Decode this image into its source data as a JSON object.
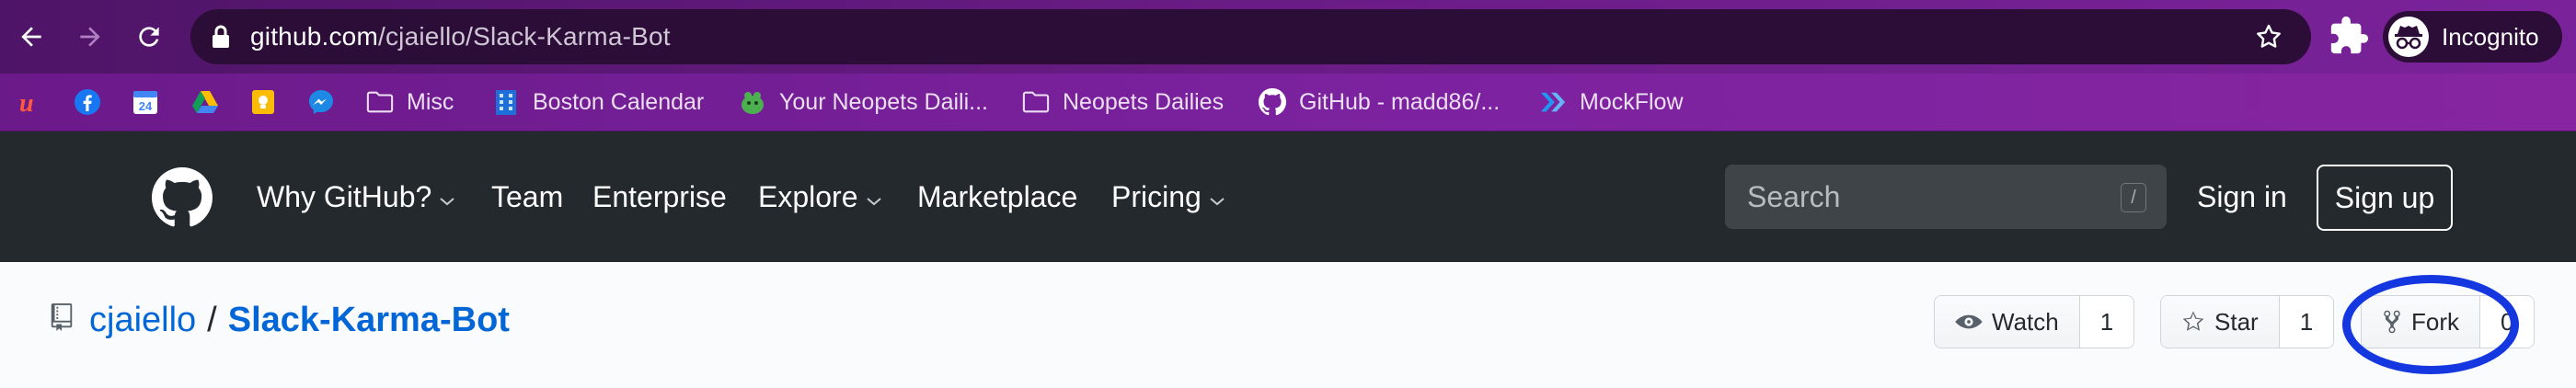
{
  "browser": {
    "url_host": "github.com",
    "url_path": "/cjaiello/Slack-Karma-Bot",
    "profile_label": "Incognito",
    "icons": [
      "back-arrow-icon",
      "forward-arrow-icon",
      "reload-icon",
      "lock-icon",
      "star-icon",
      "puzzle-icon",
      "incognito-icon"
    ]
  },
  "bookmarks": [
    {
      "label": "",
      "icon": "u-logo-icon"
    },
    {
      "label": "",
      "icon": "facebook-icon"
    },
    {
      "label": "",
      "icon": "calendar-24-icon",
      "badge": "24"
    },
    {
      "label": "",
      "icon": "google-drive-icon"
    },
    {
      "label": "",
      "icon": "keep-bulb-icon"
    },
    {
      "label": "",
      "icon": "messenger-icon"
    },
    {
      "label": "Misc",
      "icon": "folder-icon"
    },
    {
      "label": "Boston Calendar",
      "icon": "building-icon"
    },
    {
      "label": "Your Neopets Daili...",
      "icon": "neopets-icon"
    },
    {
      "label": "Neopets Dailies",
      "icon": "folder-icon"
    },
    {
      "label": "GitHub - madd86/...",
      "icon": "github-icon"
    },
    {
      "label": "MockFlow",
      "icon": "mockflow-icon"
    }
  ],
  "github_nav": {
    "items": [
      {
        "label": "Why GitHub?",
        "dropdown": true
      },
      {
        "label": "Team",
        "dropdown": false
      },
      {
        "label": "Enterprise",
        "dropdown": false
      },
      {
        "label": "Explore",
        "dropdown": true
      },
      {
        "label": "Marketplace",
        "dropdown": false
      },
      {
        "label": "Pricing",
        "dropdown": true
      }
    ],
    "search_placeholder": "Search",
    "search_shortcut": "/",
    "sign_in": "Sign in",
    "sign_up": "Sign up"
  },
  "repo": {
    "owner": "cjaiello",
    "separator": "/",
    "name": "Slack-Karma-Bot",
    "watch_label": "Watch",
    "watch_count": "1",
    "star_label": "Star",
    "star_count": "1",
    "fork_label": "Fork",
    "fork_count": "0"
  },
  "colors": {
    "browser_purple": "#6a1c86",
    "github_header": "#24292e",
    "link_blue": "#0366d6",
    "annotation_blue": "#1437e0"
  }
}
